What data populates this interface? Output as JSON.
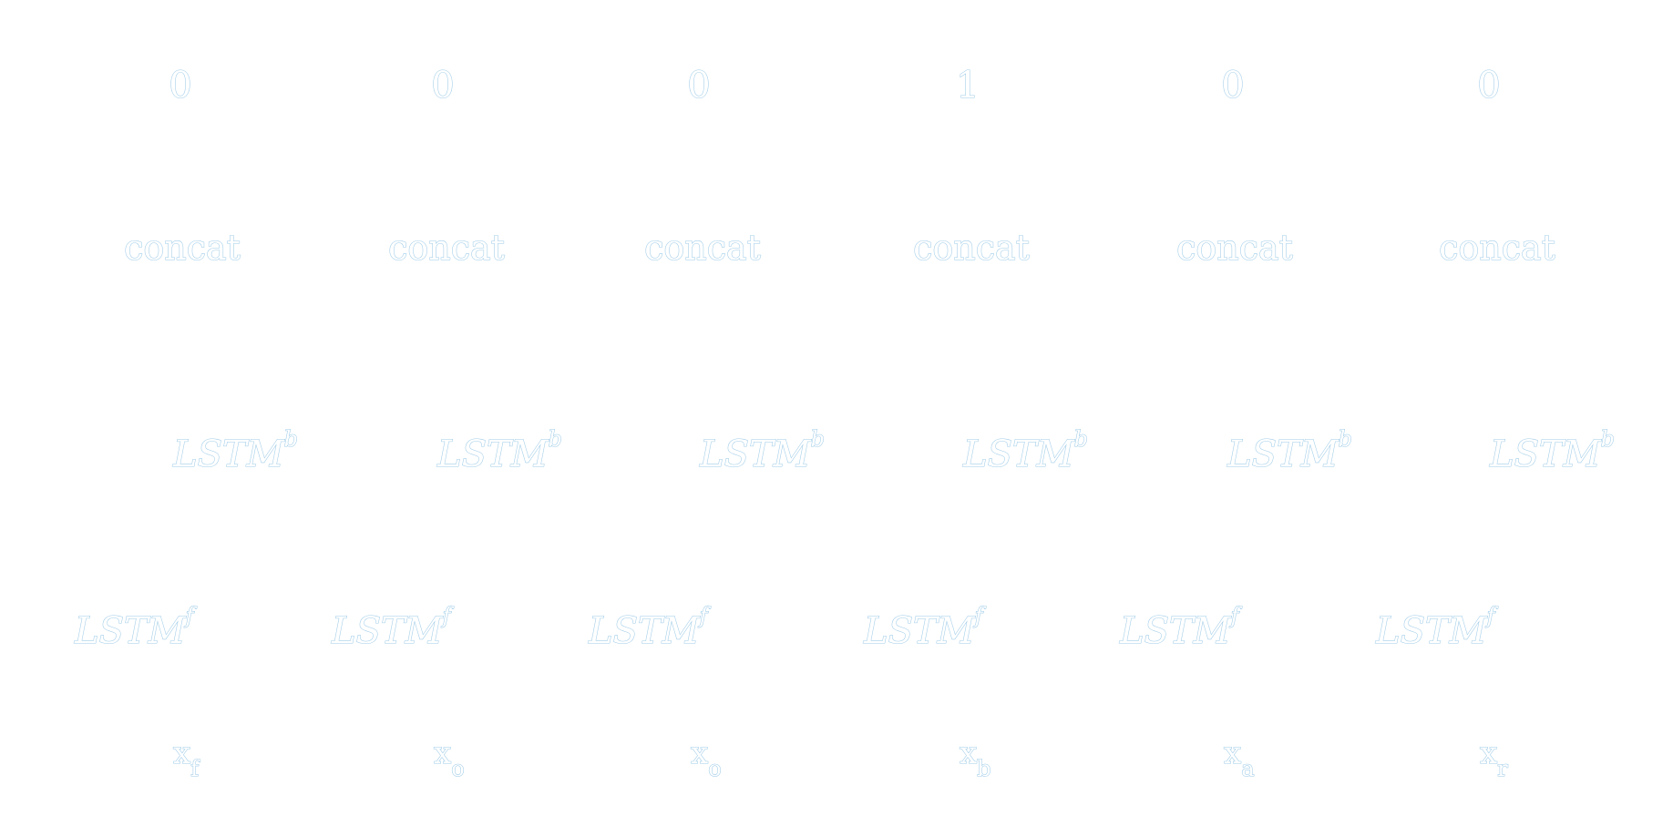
{
  "outputs": [
    "0",
    "0",
    "0",
    "1",
    "0",
    "0"
  ],
  "concat_label": "concat",
  "lstm_backward": {
    "base": "LSTM",
    "sup": "b"
  },
  "lstm_forward": {
    "base": "LSTM",
    "sup": "f"
  },
  "input_symbol": "x",
  "input_subscripts": [
    "f",
    "o",
    "o",
    "b",
    "a",
    "r"
  ]
}
